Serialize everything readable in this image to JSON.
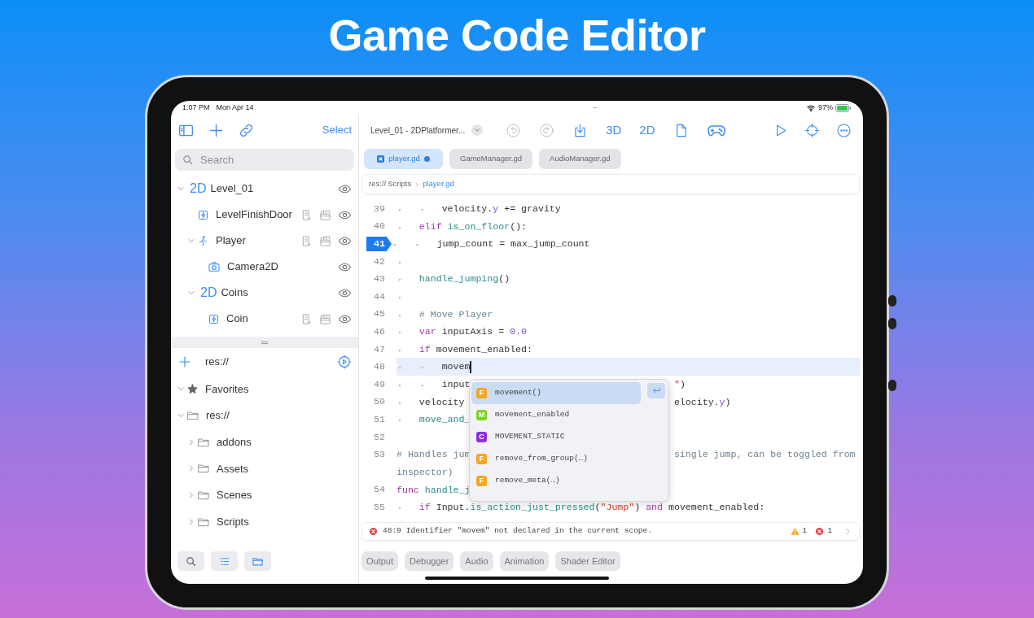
{
  "page_title": "Game Code Editor",
  "status_bar": {
    "time": "1:07 PM",
    "date": "Mon Apr 14",
    "battery": "97%"
  },
  "sidebar": {
    "select_label": "Select",
    "search": {
      "placeholder": "Search"
    },
    "scene_tree": [
      {
        "label": "Level_01",
        "kind": "node2d",
        "badge": "2D",
        "expanded": true,
        "visible": true,
        "script": false,
        "animation": false,
        "children": [
          {
            "label": "LevelFinishDoor",
            "kind": "area",
            "visible": true,
            "script": true,
            "animation": true
          },
          {
            "label": "Player",
            "kind": "character",
            "expanded": true,
            "visible": true,
            "script": true,
            "animation": true,
            "children": [
              {
                "label": "Camera2D",
                "kind": "camera",
                "visible": true,
                "script": false,
                "animation": false
              }
            ]
          },
          {
            "label": "Coins",
            "kind": "node2d",
            "badge": "2D",
            "expanded": true,
            "visible": true,
            "script": false,
            "animation": false,
            "children": [
              {
                "label": "Coin",
                "kind": "area",
                "visible": true,
                "script": true,
                "animation": true
              }
            ]
          }
        ]
      }
    ],
    "filesystem": {
      "path": "res://",
      "items": [
        {
          "label": "Favorites",
          "kind": "favorites",
          "expanded": true
        },
        {
          "label": "res://",
          "kind": "folder",
          "expanded": true,
          "children": [
            {
              "label": "addons",
              "kind": "folder",
              "expanded": false
            },
            {
              "label": "Assets",
              "kind": "folder",
              "expanded": false
            },
            {
              "label": "Scenes",
              "kind": "folder",
              "expanded": false
            },
            {
              "label": "Scripts",
              "kind": "folder",
              "expanded": false
            }
          ]
        }
      ]
    }
  },
  "editor": {
    "scene_name": "Level_01 - 2DPlatformer...",
    "toolbar": [
      {
        "kind": "undo",
        "disabled": true
      },
      {
        "kind": "redo",
        "disabled": true
      },
      {
        "kind": "save",
        "disabled": false
      },
      {
        "kind": "text",
        "label": "3D",
        "disabled": false
      },
      {
        "kind": "text",
        "label": "2D",
        "disabled": false
      },
      {
        "kind": "script",
        "disabled": false
      },
      {
        "kind": "gamepad",
        "disabled": false
      }
    ],
    "toolbar_right": [
      {
        "kind": "play"
      },
      {
        "kind": "target"
      },
      {
        "kind": "more"
      }
    ],
    "tabs": [
      {
        "label": "player.gd",
        "selected": true,
        "modified": true
      },
      {
        "label": "GameManager.gd",
        "selected": false,
        "modified": false
      },
      {
        "label": "AudioManager.gd",
        "selected": false,
        "modified": false
      }
    ],
    "breadcrumb": [
      "res://",
      "Scripts",
      "player.gd"
    ],
    "code": [
      {
        "number": "39",
        "indent": [
          "▸",
          "▸"
        ],
        "tokens": [
          {
            "kind": "plain",
            "text": "velocity."
          },
          {
            "kind": "member",
            "text": "y"
          },
          {
            "kind": "plain",
            "text": " += gravity"
          }
        ]
      },
      {
        "number": "40",
        "indent": [
          "▸"
        ],
        "tokens": [
          {
            "kind": "keyword",
            "text": "elif"
          },
          {
            "kind": "function",
            "text": " is_on_floor"
          },
          {
            "kind": "plain",
            "text": "():"
          }
        ]
      },
      {
        "number": "41",
        "indent": [
          "▸",
          "▸"
        ],
        "breakpoint": true,
        "tokens": [
          {
            "kind": "plain",
            "text": "jump_count = max_jump_count"
          }
        ]
      },
      {
        "number": "42",
        "indent": [
          "▸"
        ]
      },
      {
        "number": "43",
        "indent": [
          "▸"
        ],
        "tokens": [
          {
            "kind": "function",
            "text": "handle_jumping"
          },
          {
            "kind": "plain",
            "text": "()"
          }
        ]
      },
      {
        "number": "44",
        "indent": [
          "▸"
        ]
      },
      {
        "number": "45",
        "indent": [
          "▸"
        ],
        "tokens": [
          {
            "kind": "comment",
            "text": "# Move Player"
          }
        ]
      },
      {
        "number": "46",
        "indent": [
          "▸"
        ],
        "tokens": [
          {
            "kind": "keyword",
            "text": "var"
          },
          {
            "kind": "plain",
            "text": " inputAxis = "
          },
          {
            "kind": "number",
            "text": "0.0"
          }
        ]
      },
      {
        "number": "47",
        "indent": [
          "▸"
        ],
        "tokens": [
          {
            "kind": "keyword",
            "text": "if"
          },
          {
            "kind": "plain",
            "text": " movement_enabled:"
          }
        ]
      },
      {
        "number": "48",
        "indent": [
          "▸",
          "▸"
        ],
        "current": true,
        "tokens": [
          {
            "kind": "plain",
            "text": "movem"
          }
        ]
      },
      {
        "number": "49",
        "indent": [
          "▸",
          "▸"
        ],
        "tokens": [
          {
            "kind": "plain",
            "text": "input"
          }
        ],
        "tail": [
          {
            "kind": "string",
            "text": "\""
          },
          {
            "kind": "plain",
            "text": ")"
          }
        ]
      },
      {
        "number": "50",
        "indent": [
          "▸"
        ],
        "tokens": [
          {
            "kind": "plain",
            "text": "velocity"
          }
        ],
        "tail": [
          {
            "kind": "plain",
            "text": "elocity."
          },
          {
            "kind": "member",
            "text": "y"
          },
          {
            "kind": "plain",
            "text": ")"
          }
        ]
      },
      {
        "number": "51",
        "indent": [
          "▸"
        ],
        "tokens": [
          {
            "kind": "function",
            "text": "move_and_"
          }
        ]
      },
      {
        "number": "52"
      },
      {
        "number": "53",
        "tokens": [
          {
            "kind": "comment",
            "text": "# Handles jum"
          }
        ],
        "tail": [
          {
            "kind": "comment",
            "text": "single jump, can be toggled from"
          }
        ],
        "wrap": [
          {
            "kind": "comment",
            "text": "inspector)"
          }
        ]
      },
      {
        "number": "54",
        "tokens": [
          {
            "kind": "keyword",
            "text": "func"
          },
          {
            "kind": "function",
            "text": " handle_j"
          }
        ]
      },
      {
        "number": "55",
        "indent": [
          "▸"
        ],
        "tokens": [
          {
            "kind": "keyword",
            "text": "if"
          },
          {
            "kind": "plain",
            "text": " Input."
          },
          {
            "kind": "function",
            "text": "is_action_just_pressed"
          },
          {
            "kind": "plain",
            "text": "("
          },
          {
            "kind": "string",
            "text": "\"Jump\""
          },
          {
            "kind": "plain",
            "text": ") "
          },
          {
            "kind": "keyword",
            "text": "and"
          },
          {
            "kind": "plain",
            "text": " movement_enabled:"
          }
        ]
      }
    ],
    "autocomplete": [
      {
        "badge": "F",
        "color": "#f5a623",
        "label": "movement()",
        "selected": true
      },
      {
        "badge": "M",
        "color": "#7ed321",
        "label": "movement_enabled",
        "selected": false
      },
      {
        "badge": "C",
        "color": "#8e2de2",
        "label": "MOVEMENT_STATIC",
        "selected": false
      },
      {
        "badge": "F",
        "color": "#f5a623",
        "label": "remove_from_group(…)",
        "selected": false
      },
      {
        "badge": "F",
        "color": "#f5a623",
        "label": "remove_meta(…)",
        "selected": false
      }
    ],
    "diagnostic": {
      "position": "48:9",
      "message": "Identifier \"movem\" not declared in the current scope.",
      "warnings": "1",
      "errors": "1"
    },
    "bottom_panels": [
      "Output",
      "Debugger",
      "Audio",
      "Animation",
      "Shader Editor"
    ]
  }
}
